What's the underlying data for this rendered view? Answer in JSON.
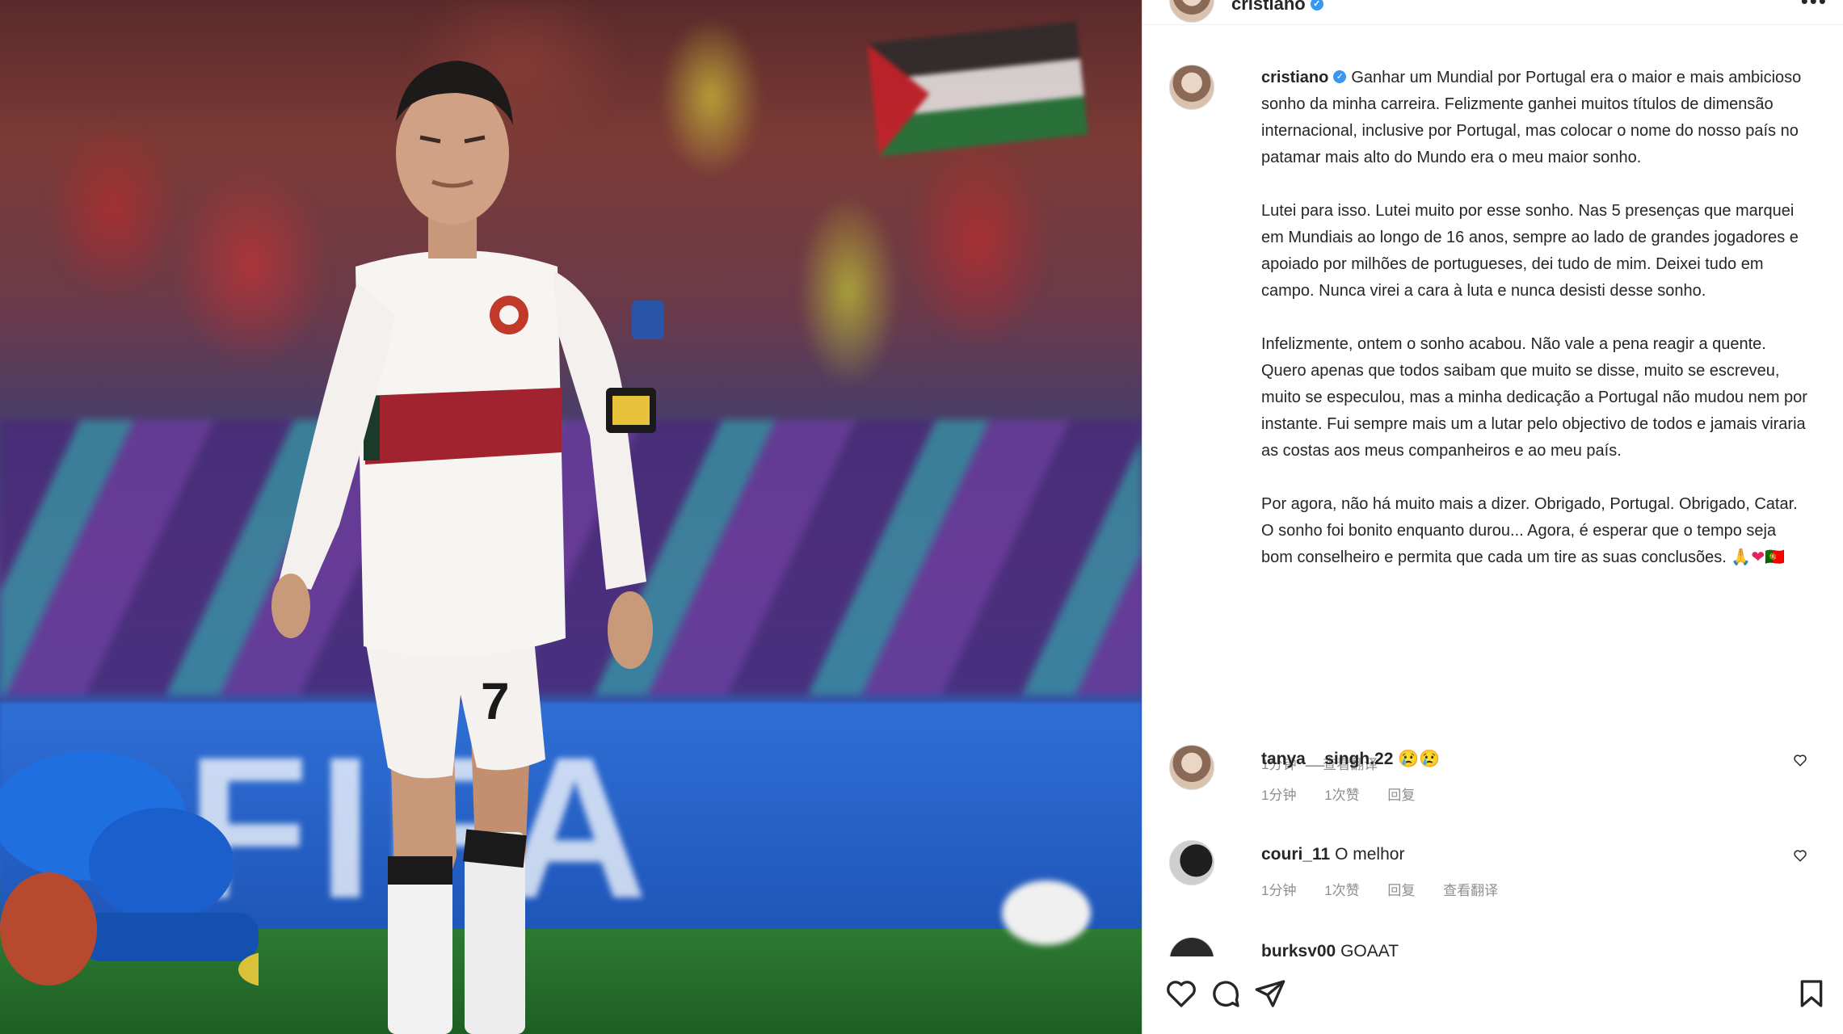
{
  "post_header": {
    "username": "cristiano",
    "avatar_icon": "profile-avatar-icon",
    "verified_icon": "verified-badge-icon",
    "more_icon": "more-options-icon"
  },
  "caption": {
    "username": "cristiano",
    "paragraphs": [
      "Ganhar um Mundial por Portugal era o maior e mais ambicioso sonho da minha carreira. Felizmente ganhei muitos títulos de dimensão internacional, inclusive por Portugal, mas colocar o nome do nosso país no patamar mais alto do Mundo era o meu maior sonho.",
      "Lutei para isso. Lutei muito por esse sonho. Nas 5 presenças que marquei em Mundiais ao longo de 16 anos, sempre ao lado de grandes jogadores e apoiado por milhões de portugueses, dei tudo de mim. Deixei tudo em campo. Nunca virei a cara à luta e nunca desisti desse sonho.",
      "Infelizmente, ontem o sonho acabou. Não vale a pena reagir a quente. Quero apenas que todos saibam que muito se disse, muito se escreveu, muito se especulou, mas a minha dedicação a Portugal não mudou nem por instante. Fui sempre mais um a lutar pelo objectivo de todos e jamais viraria as costas aos meus companheiros e ao meu país.",
      "Por agora, não há muito mais a dizer. Obrigado, Portugal. Obrigado, Catar. O sonho foi bonito enquanto durou... Agora, é esperar que o tempo seja bom conselheiro e permita que cada um tire as suas conclusões."
    ],
    "emoji_pray": "🙏",
    "emoji_heart": "❤",
    "emoji_suffix": "🇵🇹",
    "meta_time": "1分钟",
    "meta_translate": "查看翻译"
  },
  "comments": [
    {
      "username": "tanya__singh.22",
      "text": "😢😢",
      "time": "1分钟",
      "likes": "1次赞",
      "reply": "回复",
      "translate": ""
    },
    {
      "username": "couri_11",
      "text": "O melhor",
      "time": "1分钟",
      "likes": "1次赞",
      "reply": "回复",
      "translate": "查看翻译"
    },
    {
      "username": "burksy00",
      "text": "GOAAT",
      "time": "",
      "likes": "",
      "reply": "",
      "translate": ""
    }
  ],
  "actions": {
    "like_icon": "heart-icon",
    "comment_icon": "comment-bubble-icon",
    "share_icon": "send-icon",
    "save_icon": "bookmark-icon"
  },
  "colors": {
    "verified": "#3897f0",
    "meta_gray": "#8e8e8e",
    "text": "#262626",
    "border": "#dbdbdb"
  }
}
